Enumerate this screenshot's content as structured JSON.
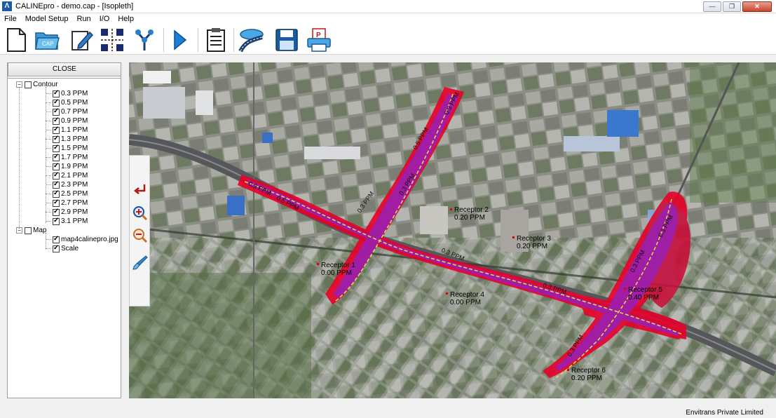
{
  "window": {
    "title": "CALINEpro - demo.cap - [Isopleth]",
    "icon": "app-logo-icon"
  },
  "menu": [
    "File",
    "Model Setup",
    "Run",
    "I/O",
    "Help"
  ],
  "toolbar": {
    "buttons": [
      {
        "name": "new-file-icon"
      },
      {
        "name": "open-cap-icon",
        "label": "CAP"
      },
      {
        "name": "edit-pencil-icon"
      },
      {
        "name": "road-grid-icon"
      },
      {
        "name": "receptor-tree-icon"
      },
      {
        "name": "run-play-icon"
      },
      {
        "name": "report-list-icon"
      },
      {
        "name": "map-road-icon"
      },
      {
        "name": "save-disk-icon"
      },
      {
        "name": "print-pdf-icon",
        "label": "P"
      }
    ]
  },
  "panel": {
    "close_label": "CLOSE",
    "contour_label": "Contour",
    "contours": [
      "0.3 PPM",
      "0.5 PPM",
      "0.7 PPM",
      "0.9 PPM",
      "1.1 PPM",
      "1.3 PPM",
      "1.5 PPM",
      "1.7 PPM",
      "1.9 PPM",
      "2.1 PPM",
      "2.3 PPM",
      "2.5 PPM",
      "2.7 PPM",
      "2.9 PPM",
      "3.1 PPM"
    ],
    "map_label": "Map",
    "map_items": [
      "map4calinepro.jpg",
      "Scale"
    ]
  },
  "map": {
    "receptors": [
      {
        "name": "Receptor 2",
        "value": "0.20 PPM"
      },
      {
        "name": "Receptor 3",
        "value": "0.20 PPM"
      },
      {
        "name": "Receptor 1",
        "value": "0.00 PPM"
      },
      {
        "name": "Receptor 4",
        "value": "0.00 PPM"
      },
      {
        "name": "Receptor 5",
        "value": "0.40 PPM"
      },
      {
        "name": "Receptor 6",
        "value": "0.20 PPM"
      }
    ],
    "contour_labels": [
      "0.3 PPM",
      "0.5 PPM",
      "0.3 PPM",
      "0.3 PPM",
      "0.5 PPM",
      "0.3 PPM",
      "0.3 PPM",
      "0.3 PPM",
      "0.3 PPM",
      "0.3 PPM",
      "0.3 PPM"
    ]
  },
  "status": {
    "company": "Envitrans Private Limited"
  },
  "colors": {
    "contour_outer": "#e8002a",
    "contour_inner": "#9b1fb0",
    "road_center": "#e8e040",
    "accent_blue": "#1a6fd6"
  }
}
